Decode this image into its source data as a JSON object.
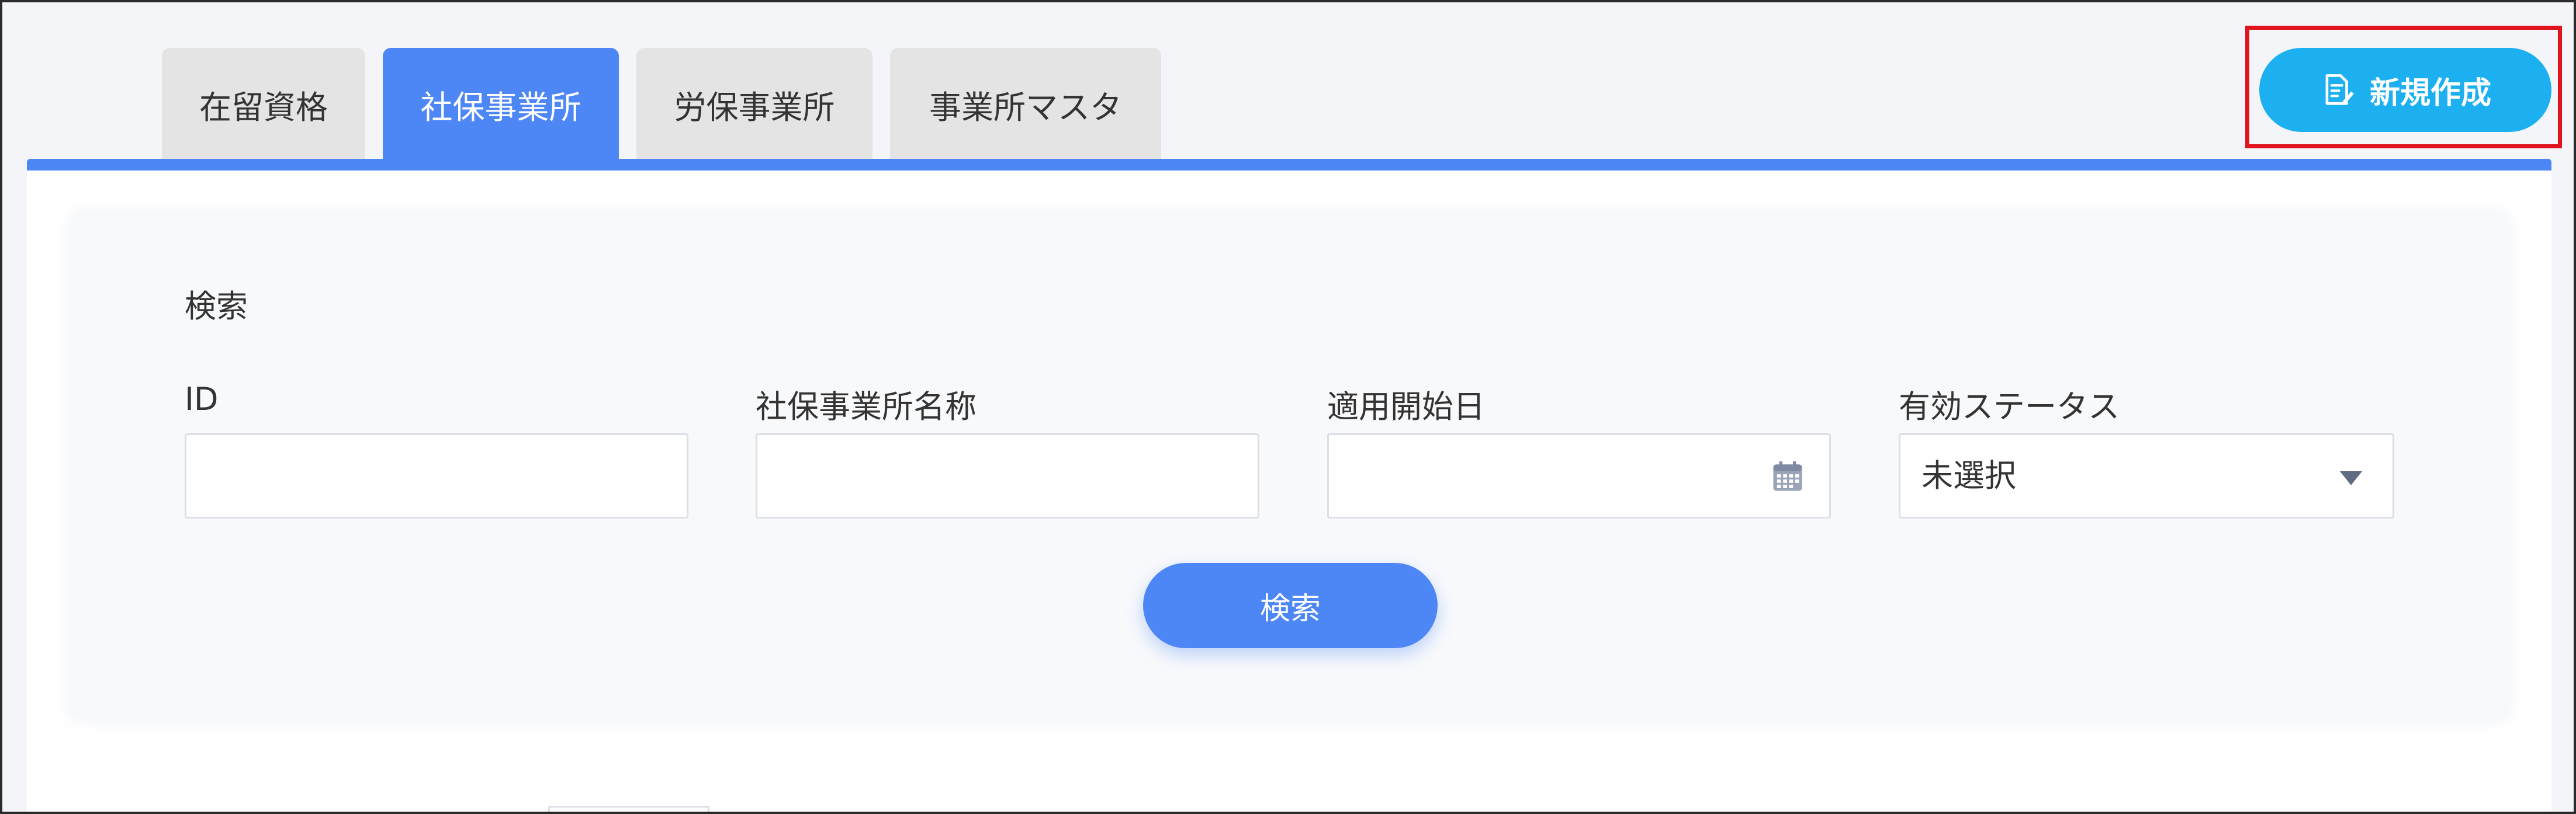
{
  "tabs": [
    {
      "label": "在留資格",
      "active": false
    },
    {
      "label": "社保事業所",
      "active": true
    },
    {
      "label": "労保事業所",
      "active": false
    },
    {
      "label": "事業所マスタ",
      "active": false
    }
  ],
  "toolbar": {
    "new_label": "新規作成",
    "new_icon": "edit-document-icon"
  },
  "search": {
    "title": "検索",
    "fields": {
      "id": {
        "label": "ID",
        "value": ""
      },
      "office_name": {
        "label": "社保事業所名称",
        "value": ""
      },
      "start_date": {
        "label": "適用開始日",
        "value": "",
        "icon": "calendar-icon"
      },
      "status": {
        "label": "有効ステータス",
        "value": "未選択"
      }
    },
    "button_label": "検索"
  },
  "colors": {
    "accent": "#4d86f5",
    "new_button": "#1cb0f0",
    "highlight_border": "#e0141e",
    "tab_inactive": "#e4e4e4"
  }
}
